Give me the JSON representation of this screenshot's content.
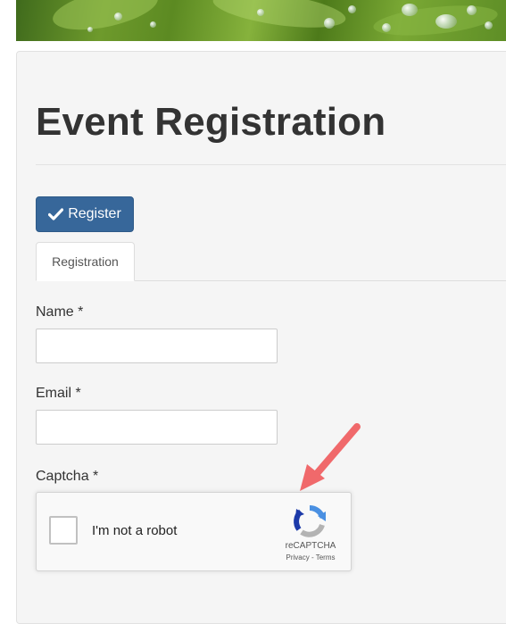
{
  "header": {
    "banner": "green-leaves-with-water-drops"
  },
  "page": {
    "title": "Event Registration"
  },
  "toolbar": {
    "register_label": "Register",
    "register_icon": "checkmark-icon"
  },
  "tabs": [
    {
      "label": "Registration",
      "active": true
    }
  ],
  "form": {
    "name": {
      "label": "Name *",
      "value": ""
    },
    "email": {
      "label": "Email *",
      "value": ""
    },
    "captcha": {
      "label": "Captcha *",
      "checkbox_label": "I'm not a robot",
      "brand": "reCAPTCHA",
      "privacy_label": "Privacy",
      "separator": " - ",
      "terms_label": "Terms",
      "checked": false
    }
  },
  "annotation": {
    "arrow_color": "#f0696b"
  },
  "colors": {
    "primary_button": "#37679a",
    "panel_background": "#f5f5f5"
  }
}
